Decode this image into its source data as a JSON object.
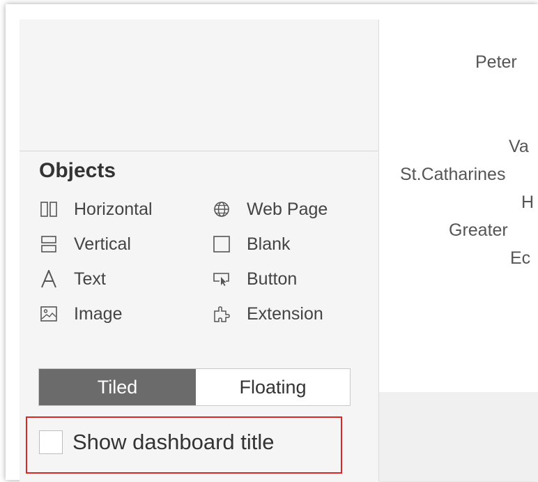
{
  "objects_panel": {
    "title": "Objects",
    "items": [
      {
        "label": "Horizontal",
        "icon": "horizontal-container-icon"
      },
      {
        "label": "Web Page",
        "icon": "globe-icon"
      },
      {
        "label": "Vertical",
        "icon": "vertical-container-icon"
      },
      {
        "label": "Blank",
        "icon": "blank-square-icon"
      },
      {
        "label": "Text",
        "icon": "text-a-icon"
      },
      {
        "label": "Button",
        "icon": "button-cursor-icon"
      },
      {
        "label": "Image",
        "icon": "image-icon"
      },
      {
        "label": "Extension",
        "icon": "puzzle-piece-icon"
      }
    ]
  },
  "layout_toggle": {
    "tiled_label": "Tiled",
    "floating_label": "Floating",
    "selected": "Tiled"
  },
  "show_title": {
    "label": "Show dashboard title",
    "checked": false
  },
  "canvas_cities": [
    "Peter",
    "Va",
    "St.Catharines",
    "H",
    "Greater",
    "Ec"
  ],
  "colors": {
    "panel_bg": "#f5f5f5",
    "selected_segment": "#6b6b6b",
    "highlight_border": "#e02424"
  }
}
